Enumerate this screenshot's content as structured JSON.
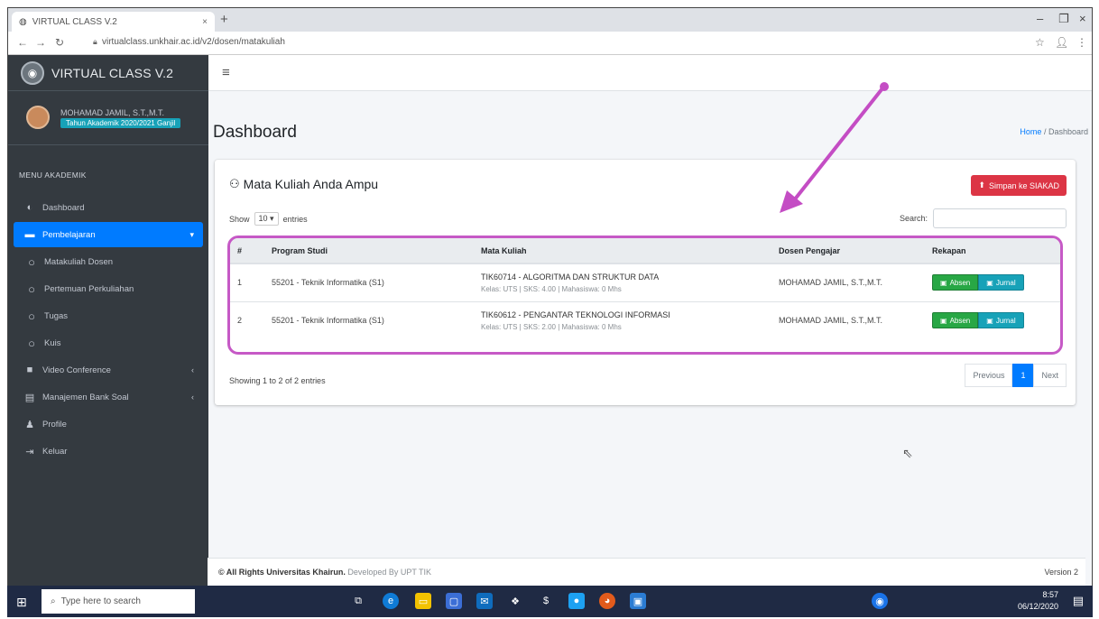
{
  "browser": {
    "tab_title": "VIRTUAL CLASS V.2",
    "tab_close": "×",
    "new_tab": "+",
    "url": "virtualclass.unkhair.ac.id/v2/dosen/matakuliah",
    "controls": {
      "minimize": "–",
      "restore": "❐",
      "close": "×"
    }
  },
  "brand": {
    "name": "VIRTUAL CLASS V.2"
  },
  "user": {
    "name": "MOHAMAD JAMIL, S.T.,M.T.",
    "status": "Tahun Akademik 2020/2021 Ganjil"
  },
  "sidebar": {
    "menu_header": "MENU AKADEMIK",
    "items": [
      {
        "label": "Dashboard",
        "icon": "dashboard-icon",
        "active": false,
        "sub": false
      },
      {
        "label": "Pembelajaran",
        "icon": "book-icon",
        "active": true,
        "sub": false,
        "arrow": "▾"
      },
      {
        "label": "Matakuliah Dosen",
        "icon": "circle-icon",
        "active": false,
        "sub": true
      },
      {
        "label": "Pertemuan Perkuliahan",
        "icon": "circle-icon",
        "active": false,
        "sub": true
      },
      {
        "label": "Tugas",
        "icon": "circle-icon",
        "active": false,
        "sub": true
      },
      {
        "label": "Kuis",
        "icon": "circle-icon",
        "active": false,
        "sub": true
      },
      {
        "label": "Video Conference",
        "icon": "video-icon",
        "active": false,
        "sub": false,
        "arrow": "‹"
      },
      {
        "label": "Manajemen Bank Soal",
        "icon": "list-icon",
        "active": false,
        "sub": false,
        "arrow": "‹"
      },
      {
        "label": "Profile",
        "icon": "user-icon",
        "active": false,
        "sub": false
      },
      {
        "label": "Keluar",
        "icon": "logout-icon",
        "active": false,
        "sub": false
      }
    ]
  },
  "header": {
    "page_title": "Dashboard",
    "breadcrumb_home": "Home",
    "breadcrumb_sep": "/",
    "breadcrumb_current": "Dashboard"
  },
  "card": {
    "title": "Mata Kuliah Anda Ampu",
    "export_button": "Simpan ke SIAKAD",
    "show_label": "Show",
    "show_value": "10",
    "entries_label": "entries",
    "search_label": "Search:",
    "search_placeholder": "",
    "columns": [
      "#",
      "Program Studi",
      "Mata Kuliah",
      "Dosen Pengajar",
      "Rekapan"
    ],
    "rows": [
      {
        "no": "1",
        "prodi": "55201 - Teknik Informatika (S1)",
        "matkul": "TIK60714 - ALGORITMA DAN STRUKTUR DATA",
        "detail": "Kelas: UTS | SKS: 4.00 | Mahasiswa: 0 Mhs",
        "dosen": "MOHAMAD JAMIL, S.T.,M.T.",
        "btn1": "Absen",
        "btn2": "Jurnal"
      },
      {
        "no": "2",
        "prodi": "55201 - Teknik Informatika (S1)",
        "matkul": "TIK60612 - PENGANTAR TEKNOLOGI INFORMASI",
        "detail": "Kelas: UTS | SKS: 2.00 | Mahasiswa: 0 Mhs",
        "dosen": "MOHAMAD JAMIL, S.T.,M.T.",
        "btn1": "Absen",
        "btn2": "Jurnal"
      }
    ],
    "info": "Showing 1 to 2 of 2 entries",
    "pager": {
      "prev": "Previous",
      "page": "1",
      "next": "Next"
    }
  },
  "footer": {
    "left_strong": "© All Rights Universitas Khairun.",
    "left_dev": "Developed By UPT TIK",
    "right": "Version 2"
  },
  "taskbar": {
    "search_placeholder": "Type here to search",
    "time": "8:57",
    "date": "06/12/2020"
  },
  "colors": {
    "sidebar_bg": "#343a40",
    "accent": "#007bff",
    "annotation": "#c659c6",
    "export_btn": "#dc3545",
    "absen_btn": "#28a745",
    "jurnal_btn": "#17a2b8"
  }
}
